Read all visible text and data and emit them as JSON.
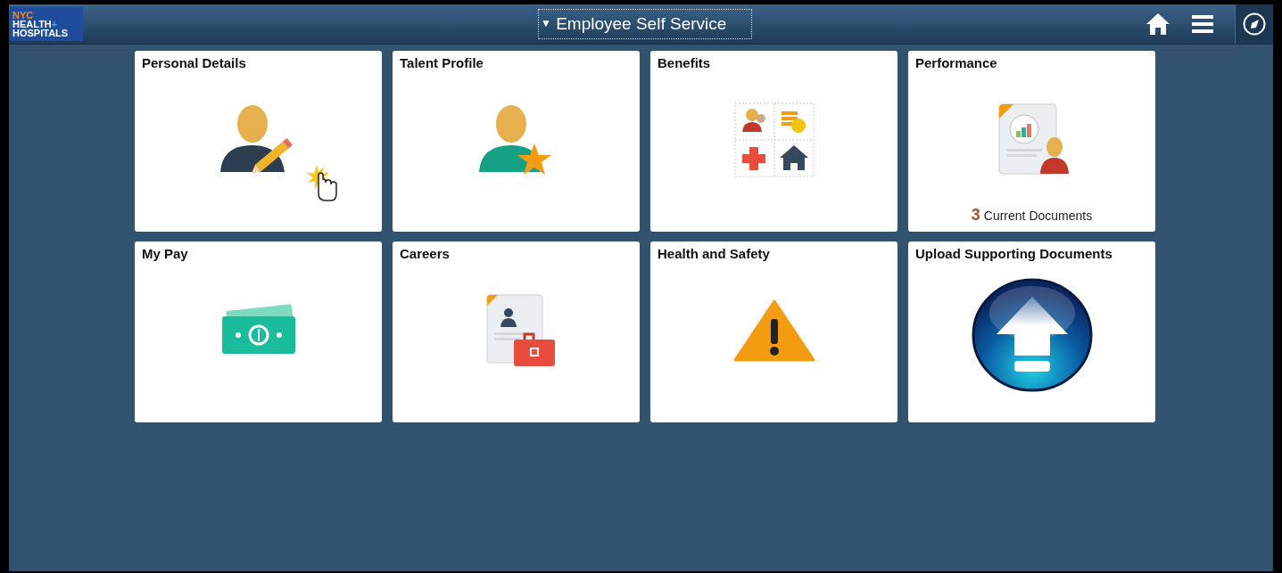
{
  "header": {
    "logo": {
      "line1": "NYC",
      "line2": "HEALTH",
      "plus": "+",
      "line3": "HOSPITALS"
    },
    "title": {
      "caret": "▼",
      "text": "Employee Self Service"
    }
  },
  "tiles": [
    {
      "title": "Personal Details",
      "kind": "personal"
    },
    {
      "title": "Talent Profile",
      "kind": "talent"
    },
    {
      "title": "Benefits",
      "kind": "benefits"
    },
    {
      "title": "Performance",
      "kind": "performance",
      "count": "3",
      "count_label": "Current Documents"
    },
    {
      "title": "My Pay",
      "kind": "pay"
    },
    {
      "title": "Careers",
      "kind": "careers"
    },
    {
      "title": "Health and Safety",
      "kind": "safety"
    },
    {
      "title": "Upload Supporting Documents",
      "kind": "upload"
    }
  ]
}
